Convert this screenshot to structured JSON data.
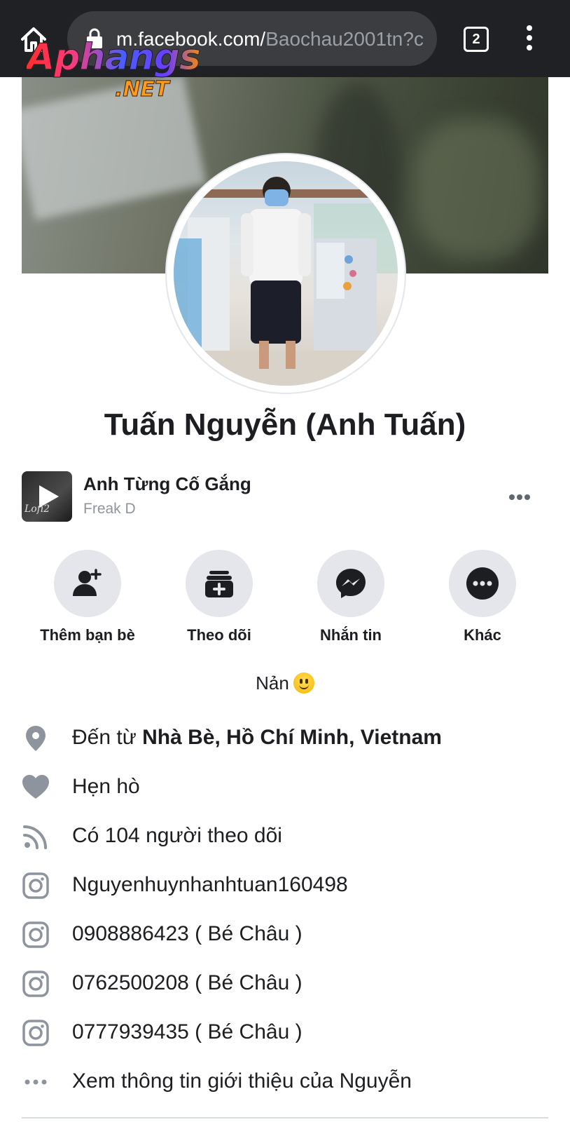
{
  "browser": {
    "url_host": "m.facebook.com/",
    "url_path": "Baochau2001tn?c",
    "tab_count": "2"
  },
  "watermark": {
    "brand": "Aphangs",
    "suffix": ".NET"
  },
  "profile": {
    "name": "Tuấn Nguyễn (Anh Tuấn)",
    "bio": "Nản"
  },
  "music": {
    "title": "Anh Từng Cố Gắng",
    "artist": "Freak D",
    "thumb_text": "Lofi2"
  },
  "actions": [
    {
      "label": "Thêm bạn bè",
      "icon": "add-friend-icon"
    },
    {
      "label": "Theo dõi",
      "icon": "follow-icon"
    },
    {
      "label": "Nhắn tin",
      "icon": "messenger-icon"
    },
    {
      "label": "Khác",
      "icon": "more-icon"
    }
  ],
  "info": {
    "from_prefix": "Đến từ ",
    "from_place": "Nhà Bè, Hồ Chí Minh, Vietnam",
    "relationship": "Hẹn hò",
    "followers": "Có 104 người theo dõi",
    "instagram": [
      "Nguyenhuynhanhtuan160498",
      "0908886423 ( Bé Châu )",
      "0762500208 ( Bé Châu )",
      "0777939435 ( Bé Châu )"
    ],
    "see_about": "Xem thông tin giới thiệu của Nguyễn"
  },
  "colors": {
    "chrome_bg": "#202124",
    "urlbar_bg": "#3c3d40",
    "action_circle": "#e4e6eb",
    "icon_gray": "#8d949e",
    "text": "#1c1e21"
  }
}
